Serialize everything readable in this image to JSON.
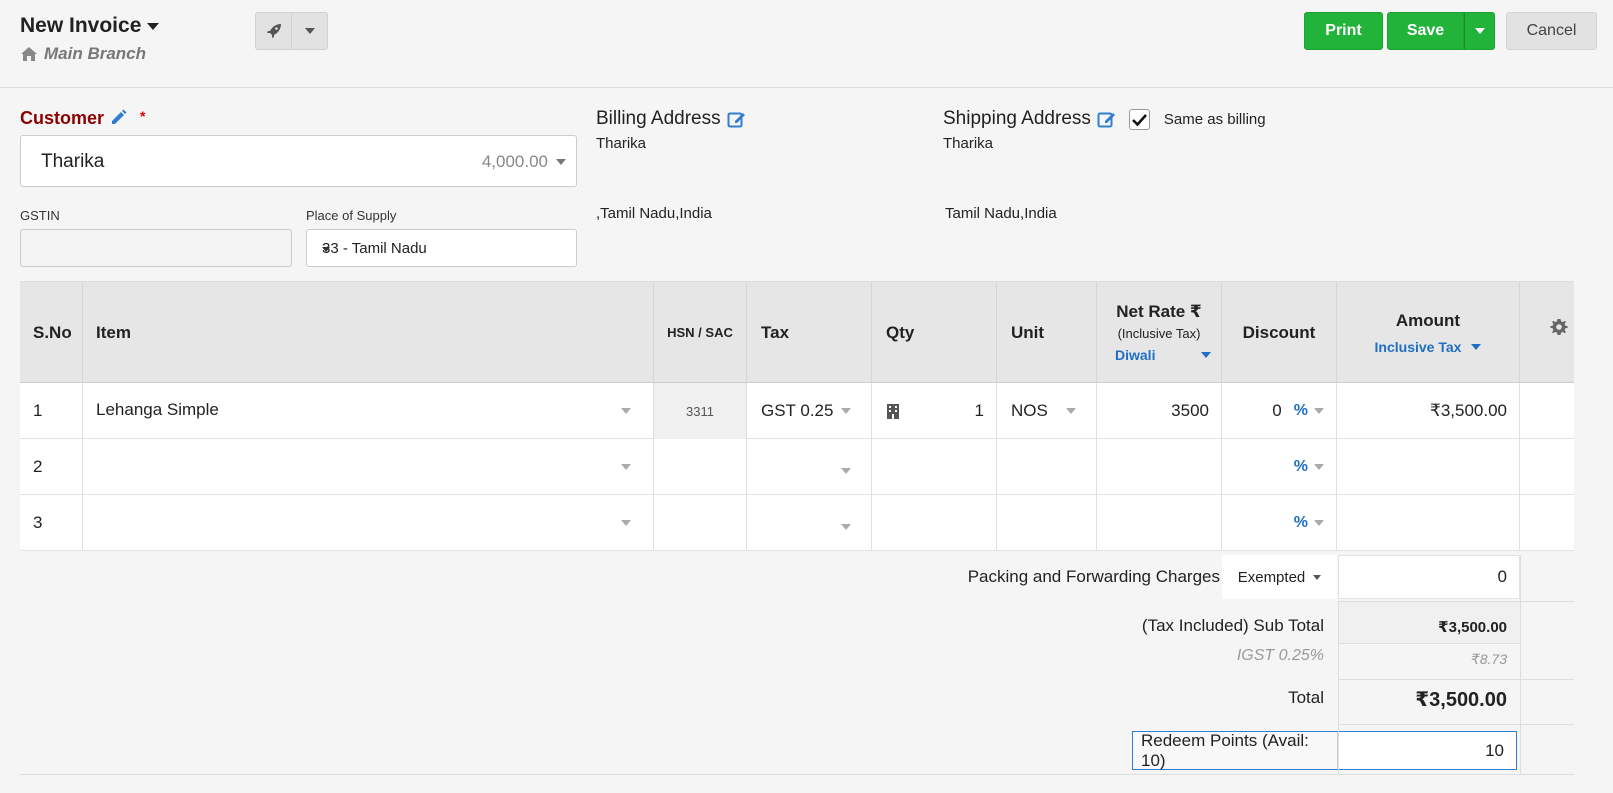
{
  "header": {
    "title": "New Invoice",
    "branch": "Main Branch",
    "print_label": "Print",
    "save_label": "Save",
    "cancel_label": "Cancel"
  },
  "customer": {
    "label": "Customer",
    "required_mark": "*",
    "name": "Tharika",
    "balance": "4,000.00"
  },
  "gstin": {
    "label": "GSTIN",
    "value": ""
  },
  "place_of_supply": {
    "label": "Place of Supply",
    "value": "33 - Tamil Nadu"
  },
  "billing": {
    "title": "Billing Address",
    "name": "Tharika",
    "line": ",Tamil Nadu,India"
  },
  "shipping": {
    "title": "Shipping Address",
    "same_label": "Same as billing",
    "same_checked": true,
    "name": "Tharika",
    "line": "Tamil Nadu,India"
  },
  "table": {
    "headers": {
      "sno": "S.No",
      "item": "Item",
      "hsn": "HSN / SAC",
      "tax": "Tax",
      "qty": "Qty",
      "unit": "Unit",
      "net_rate": "Net Rate ₹",
      "net_rate_sub": "(Inclusive Tax)",
      "price_list": "Diwali",
      "discount": "Discount",
      "amount": "Amount",
      "amount_sub": "Inclusive Tax"
    },
    "rows": [
      {
        "sno": "1",
        "item": "Lehanga Simple",
        "hsn": "3311",
        "tax": "GST 0.25",
        "qty": "1",
        "unit": "NOS",
        "rate": "3500",
        "discount": "0",
        "disc_type": "%",
        "amount": "₹3,500.00"
      },
      {
        "sno": "2",
        "item": "",
        "hsn": "",
        "tax": "",
        "qty": "",
        "unit": "",
        "rate": "",
        "discount": "",
        "disc_type": "%",
        "amount": ""
      },
      {
        "sno": "3",
        "item": "",
        "hsn": "",
        "tax": "",
        "qty": "",
        "unit": "",
        "rate": "",
        "discount": "",
        "disc_type": "%",
        "amount": ""
      }
    ]
  },
  "totals": {
    "packing_label": "Packing and Forwarding Charges",
    "packing_tax": "Exempted",
    "packing_value": "0",
    "subtotal_label": "(Tax Included) Sub Total",
    "subtotal_value": "₹3,500.00",
    "igst_label": "IGST 0.25%",
    "igst_value": "₹8.73",
    "total_label": "Total",
    "total_value": "₹3,500.00",
    "redeem_label": "Redeem Points (Avail: 10)",
    "redeem_value": "10"
  },
  "colors": {
    "primary_green": "#21b33a",
    "customer_label": "#8b0000",
    "link_blue": "#1f6fc4"
  }
}
